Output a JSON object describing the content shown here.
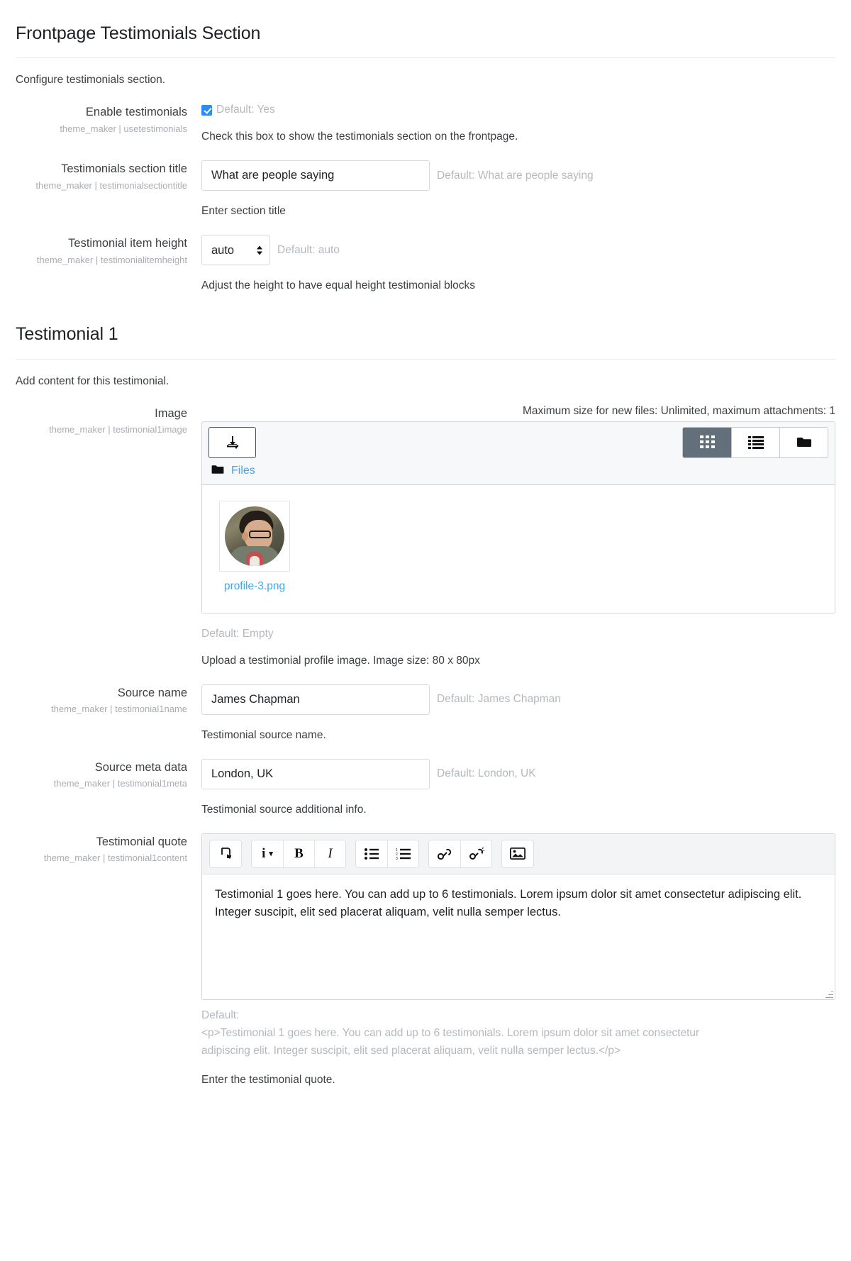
{
  "section1": {
    "title": "Frontpage Testimonials Section",
    "description": "Configure testimonials section.",
    "settings": [
      {
        "label": "Enable testimonials",
        "key": "theme_maker | usetestimonials",
        "default_note": "Default: Yes",
        "help": "Check this box to show the testimonials section on the frontpage."
      },
      {
        "label": "Testimonials section title",
        "key": "theme_maker | testimonialsectiontitle",
        "value": "What are people saying",
        "default_note": "Default: What are people saying",
        "help": "Enter section title"
      },
      {
        "label": "Testimonial item height",
        "key": "theme_maker | testimonialitemheight",
        "value": "auto",
        "options": [
          "auto"
        ],
        "default_note": "Default: auto",
        "help": "Adjust the height to have equal height testimonial blocks"
      }
    ]
  },
  "section2": {
    "title": "Testimonial 1",
    "description": "Add content for this testimonial.",
    "image_setting": {
      "label": "Image",
      "key": "theme_maker | testimonial1image",
      "max_info": "Maximum size for new files: Unlimited, maximum attachments: 1",
      "upload_icon": "upload-icon",
      "view_buttons": [
        {
          "name": "grid-view-icon",
          "active": true
        },
        {
          "name": "list-view-icon",
          "active": false
        },
        {
          "name": "tree-view-icon",
          "active": false
        }
      ],
      "path_icon": "folder-icon",
      "path_label": "Files",
      "file": {
        "thumb_name": "profile-avatar-thumbnail",
        "filename": "profile-3.png"
      },
      "default_note": "Default: Empty",
      "help": "Upload a testimonial profile image. Image size: 80 x 80px"
    },
    "name_setting": {
      "label": "Source name",
      "key": "theme_maker | testimonial1name",
      "value": "James Chapman",
      "default_note": "Default: James Chapman",
      "help": "Testimonial source name."
    },
    "meta_setting": {
      "label": "Source meta data",
      "key": "theme_maker | testimonial1meta",
      "value": "London, UK",
      "default_note": "Default: London, UK",
      "help": "Testimonial source additional info."
    },
    "quote_setting": {
      "label": "Testimonial quote",
      "key": "theme_maker | testimonial1content",
      "toolbar": [
        {
          "name": "undo-icon",
          "glyph": "⤷"
        },
        {
          "name": "styles-info-icon",
          "glyph": "i"
        },
        {
          "name": "styles-dropdown-icon",
          "glyph": "▾"
        },
        {
          "name": "bold-icon",
          "glyph": "B"
        },
        {
          "name": "italic-icon",
          "glyph": "I"
        },
        {
          "name": "bullet-list-icon",
          "glyph": "☰"
        },
        {
          "name": "numbered-list-icon",
          "glyph": "☰"
        },
        {
          "name": "link-icon",
          "glyph": "🔗"
        },
        {
          "name": "unlink-icon",
          "glyph": "🔗"
        },
        {
          "name": "image-icon",
          "glyph": "🖼"
        }
      ],
      "content": "Testimonial 1 goes here. You can add up to 6 testimonials. Lorem ipsum dolor sit amet consectetur adipiscing elit. Integer suscipit, elit sed placerat aliquam, velit nulla semper lectus.",
      "default_label": "Default:",
      "default_value": "<p>Testimonial 1 goes here. You can add up to 6 testimonials. Lorem ipsum dolor sit amet consectetur adipiscing elit. Integer suscipit, elit sed placerat aliquam, velit nulla semper lectus.</p>",
      "help": "Enter the testimonial quote."
    }
  }
}
